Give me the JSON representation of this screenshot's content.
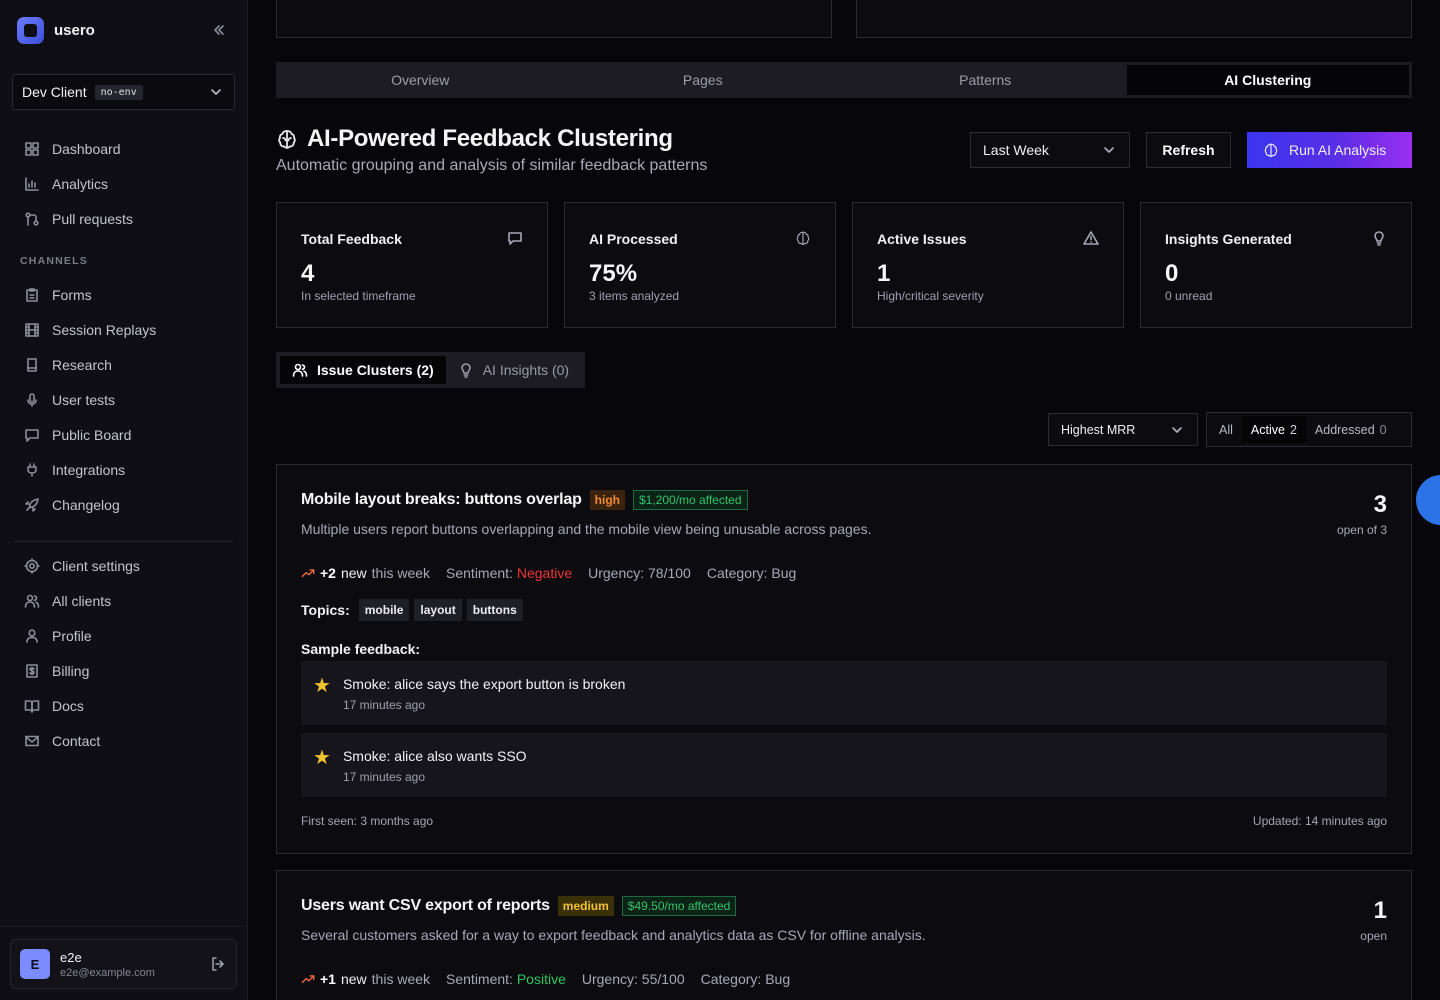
{
  "app": {
    "name": "usero"
  },
  "client": {
    "name": "Dev Client",
    "env": "no-env"
  },
  "nav": {
    "main": [
      {
        "label": "Dashboard",
        "icon": "grid-icon"
      },
      {
        "label": "Analytics",
        "icon": "bar-chart-icon"
      },
      {
        "label": "Pull requests",
        "icon": "git-pull-request-icon"
      }
    ],
    "channels_heading": "CHANNELS",
    "channels": [
      {
        "label": "Forms",
        "icon": "clipboard-icon"
      },
      {
        "label": "Session Replays",
        "icon": "film-icon"
      },
      {
        "label": "Research",
        "icon": "book-icon"
      },
      {
        "label": "User tests",
        "icon": "mic-icon"
      },
      {
        "label": "Public Board",
        "icon": "message-square-icon"
      },
      {
        "label": "Integrations",
        "icon": "plug-icon"
      },
      {
        "label": "Changelog",
        "icon": "rocket-icon"
      }
    ],
    "settings": [
      {
        "label": "Client settings",
        "icon": "gear-icon"
      },
      {
        "label": "All clients",
        "icon": "users-icon"
      },
      {
        "label": "Profile",
        "icon": "user-icon"
      },
      {
        "label": "Billing",
        "icon": "receipt-icon"
      },
      {
        "label": "Docs",
        "icon": "book-open-icon"
      },
      {
        "label": "Contact",
        "icon": "mail-icon"
      }
    ]
  },
  "user": {
    "initial": "E",
    "name": "e2e",
    "email": "e2e@example.com"
  },
  "tabs": [
    {
      "label": "Overview",
      "active": false
    },
    {
      "label": "Pages",
      "active": false
    },
    {
      "label": "Patterns",
      "active": false
    },
    {
      "label": "AI Clustering",
      "active": true
    }
  ],
  "header": {
    "title": "AI-Powered Feedback Clustering",
    "subtitle": "Automatic grouping and analysis of similar feedback patterns",
    "range": "Last Week",
    "refresh": "Refresh",
    "run": "Run AI Analysis"
  },
  "stats": [
    {
      "label": "Total Feedback",
      "value": "4",
      "sub": "In selected timeframe",
      "icon": "message-square-icon"
    },
    {
      "label": "AI Processed",
      "value": "75%",
      "sub": "3 items analyzed",
      "icon": "brain-icon"
    },
    {
      "label": "Active Issues",
      "value": "1",
      "sub": "High/critical severity",
      "icon": "alert-triangle-icon"
    },
    {
      "label": "Insights Generated",
      "value": "0",
      "sub": "0 unread",
      "icon": "lightbulb-icon"
    }
  ],
  "subtabs": [
    {
      "label": "Issue Clusters (2)",
      "active": true,
      "icon": "users-icon"
    },
    {
      "label": "AI Insights (0)",
      "active": false,
      "icon": "lightbulb-icon"
    }
  ],
  "sort": {
    "value": "Highest MRR"
  },
  "filters": [
    {
      "label": "All",
      "count": ""
    },
    {
      "label": "Active",
      "count": "2"
    },
    {
      "label": "Addressed",
      "count": "0"
    }
  ],
  "clusters": [
    {
      "title": "Mobile layout breaks: buttons overlap",
      "severity": "high",
      "mrr": "$1,200/mo affected",
      "description": "Multiple users report buttons overlapping and the mobile view being unusable across pages.",
      "count": "3",
      "count_label": "open of 3",
      "trend_value": "+2",
      "trend_new": "new",
      "trend_period": "this week",
      "sentiment_label": "Sentiment:",
      "sentiment": "Negative",
      "urgency": "Urgency: 78/100",
      "category": "Category: Bug",
      "topics_label": "Topics:",
      "topics": [
        "mobile",
        "layout",
        "buttons"
      ],
      "sample_label": "Sample feedback:",
      "samples": [
        {
          "text": "Smoke: alice says the export button is broken",
          "time": "17 minutes ago"
        },
        {
          "text": "Smoke: alice also wants SSO",
          "time": "17 minutes ago"
        }
      ],
      "first_seen": "First seen: 3 months ago",
      "updated": "Updated: 14 minutes ago"
    },
    {
      "title": "Users want CSV export of reports",
      "severity": "medium",
      "mrr": "$49.50/mo affected",
      "description": "Several customers asked for a way to export feedback and analytics data as CSV for offline analysis.",
      "count": "1",
      "count_label": "open",
      "trend_value": "+1",
      "trend_new": "new",
      "trend_period": "this week",
      "sentiment_label": "Sentiment:",
      "sentiment": "Positive",
      "urgency": "Urgency: 55/100",
      "category": "Category: Bug"
    }
  ]
}
